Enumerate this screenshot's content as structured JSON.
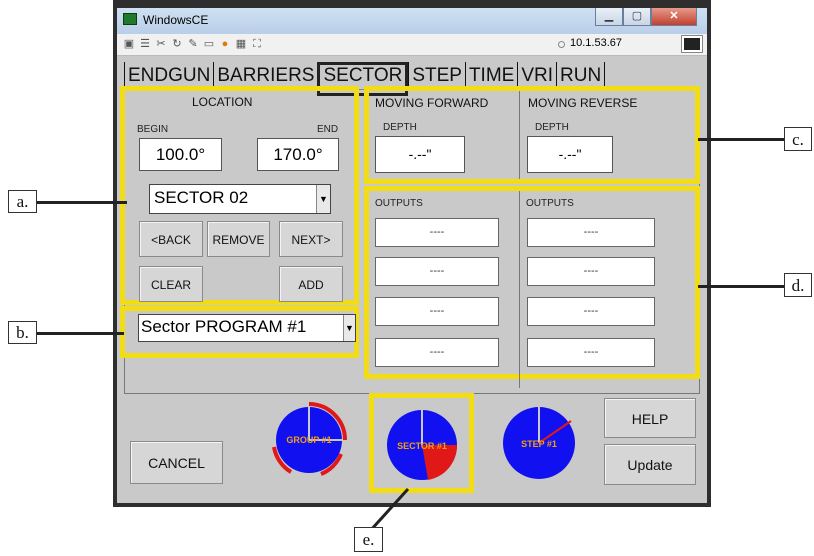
{
  "window": {
    "title": "WindowsCE"
  },
  "toolbar": {
    "ip": "10.1.53.67"
  },
  "tabs": [
    "ENDGUN",
    "BARRIERS",
    "SECTOR",
    "STEP",
    "TIME",
    "VRI",
    "RUN"
  ],
  "selected_tab": "SECTOR",
  "location": {
    "title": "LOCATION",
    "begin_label": "BEGIN",
    "end_label": "END",
    "begin_value": "100.0°",
    "end_value": "170.0°",
    "sector_select": "SECTOR 02",
    "back_label": "<BACK",
    "remove_label": "REMOVE",
    "next_label": "NEXT>",
    "clear_label": "CLEAR",
    "add_label": "ADD"
  },
  "program_select": "Sector PROGRAM #1",
  "forward": {
    "title": "MOVING FORWARD",
    "depth_label": "DEPTH",
    "depth_value": "-.--\""
  },
  "reverse": {
    "title": "MOVING REVERSE",
    "depth_label": "DEPTH",
    "depth_value": "-.--\""
  },
  "outputs": {
    "left_label": "OUTPUTS",
    "right_label": "OUTPUTS",
    "left": [
      "----",
      "----",
      "----",
      "----"
    ],
    "right": [
      "----",
      "----",
      "----",
      "----"
    ]
  },
  "bottom": {
    "cancel_label": "CANCEL",
    "help_label": "HELP",
    "update_label": "Update",
    "group_label": "GROUP #1",
    "sector_label": "SECTOR #1",
    "step_label": "STEP #1"
  },
  "callouts": {
    "a": "a.",
    "b": "b.",
    "c": "c.",
    "d": "d.",
    "e": "e."
  },
  "colors": {
    "highlight": "#f2dc13",
    "pie_blue": "#1010f0",
    "pie_red": "#e01818",
    "client_bg": "#c9c9c9"
  }
}
